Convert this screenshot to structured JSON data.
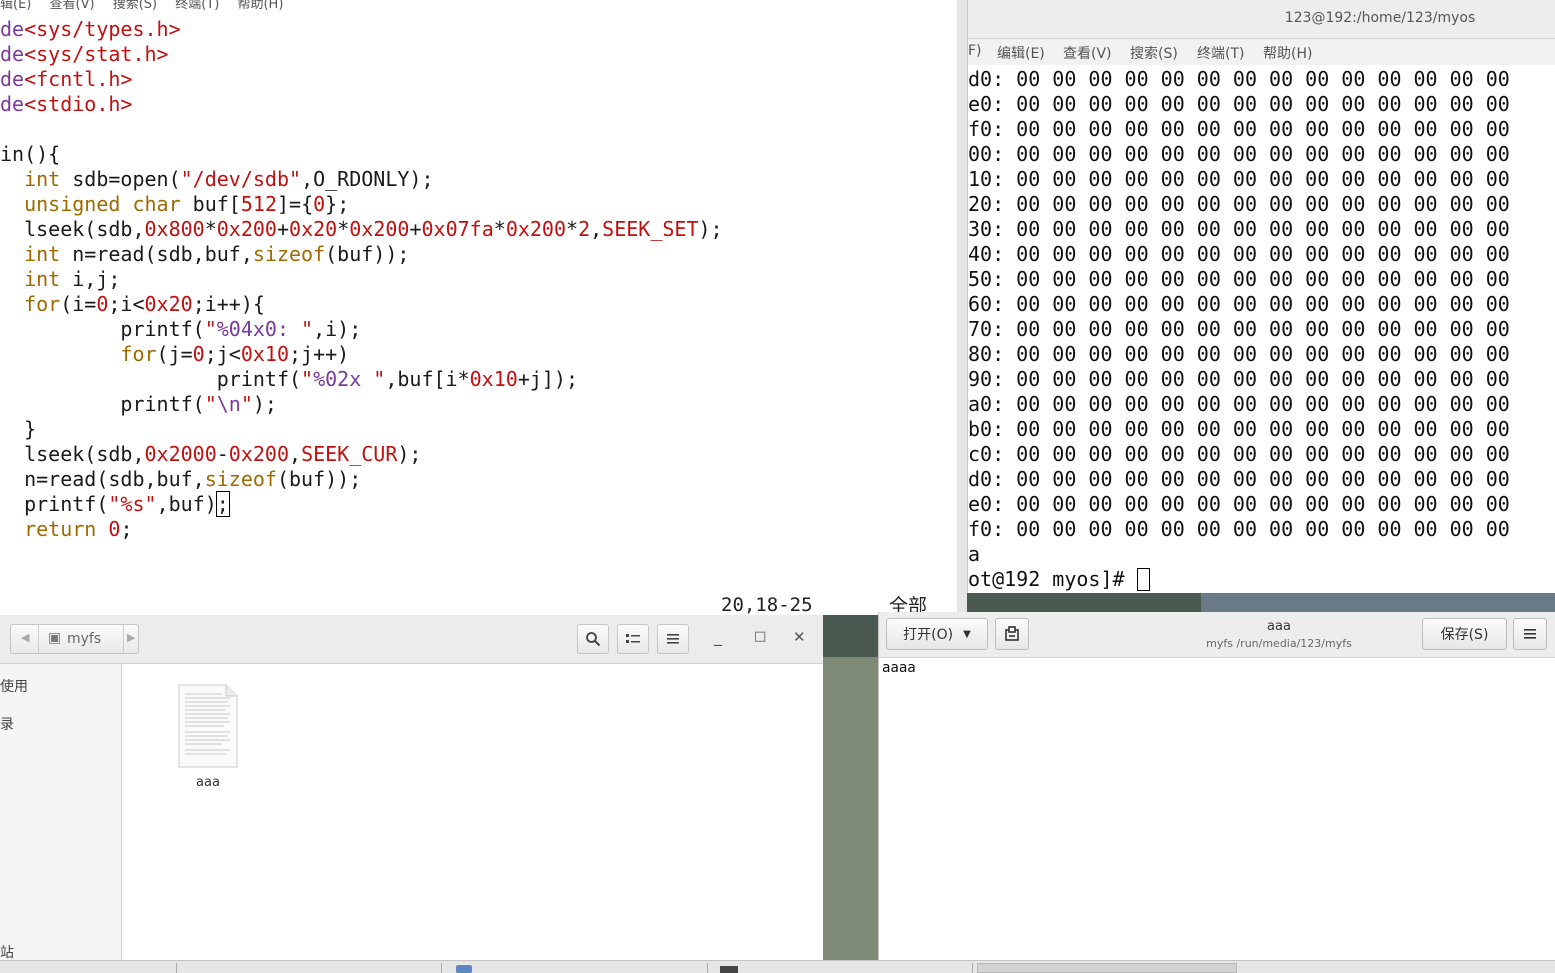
{
  "vim": {
    "menu": [
      "辑(E)",
      "查看(V)",
      "搜索(S)",
      "终端(T)",
      "帮助(H)"
    ],
    "code_lines": [
      {
        "spans": [
          {
            "c": "pp",
            "t": "de"
          },
          {
            "c": "st",
            "t": "<sys/types.h>"
          }
        ]
      },
      {
        "spans": [
          {
            "c": "pp",
            "t": "de"
          },
          {
            "c": "st",
            "t": "<sys/stat.h>"
          }
        ]
      },
      {
        "spans": [
          {
            "c": "pp",
            "t": "de"
          },
          {
            "c": "st",
            "t": "<fcntl.h>"
          }
        ]
      },
      {
        "spans": [
          {
            "c": "pp",
            "t": "de"
          },
          {
            "c": "st",
            "t": "<stdio.h>"
          }
        ]
      },
      {
        "spans": []
      },
      {
        "spans": [
          {
            "c": "",
            "t": "in(){"
          }
        ]
      },
      {
        "spans": [
          {
            "c": "",
            "t": "  "
          },
          {
            "c": "kw",
            "t": "int"
          },
          {
            "c": "",
            "t": " sdb=open("
          },
          {
            "c": "st",
            "t": "\"/dev/sdb\""
          },
          {
            "c": "",
            "t": ",O_RDONLY);"
          }
        ]
      },
      {
        "spans": [
          {
            "c": "",
            "t": "  "
          },
          {
            "c": "kw",
            "t": "unsigned char"
          },
          {
            "c": "",
            "t": " buf["
          },
          {
            "c": "nm",
            "t": "512"
          },
          {
            "c": "",
            "t": "]={"
          },
          {
            "c": "nm",
            "t": "0"
          },
          {
            "c": "",
            "t": "};"
          }
        ]
      },
      {
        "spans": [
          {
            "c": "",
            "t": "  lseek(sdb,"
          },
          {
            "c": "nm",
            "t": "0x800"
          },
          {
            "c": "",
            "t": "*"
          },
          {
            "c": "nm",
            "t": "0x200"
          },
          {
            "c": "",
            "t": "+"
          },
          {
            "c": "nm",
            "t": "0x20"
          },
          {
            "c": "",
            "t": "*"
          },
          {
            "c": "nm",
            "t": "0x200"
          },
          {
            "c": "",
            "t": "+"
          },
          {
            "c": "nm",
            "t": "0x07fa"
          },
          {
            "c": "",
            "t": "*"
          },
          {
            "c": "nm",
            "t": "0x200"
          },
          {
            "c": "",
            "t": "*"
          },
          {
            "c": "nm",
            "t": "2"
          },
          {
            "c": "",
            "t": ","
          },
          {
            "c": "st",
            "t": "SEEK_SET"
          },
          {
            "c": "",
            "t": ");"
          }
        ]
      },
      {
        "spans": [
          {
            "c": "",
            "t": "  "
          },
          {
            "c": "kw",
            "t": "int"
          },
          {
            "c": "",
            "t": " n=read(sdb,buf,"
          },
          {
            "c": "kw",
            "t": "sizeof"
          },
          {
            "c": "",
            "t": "(buf));"
          }
        ]
      },
      {
        "spans": [
          {
            "c": "",
            "t": "  "
          },
          {
            "c": "kw",
            "t": "int"
          },
          {
            "c": "",
            "t": " i,j;"
          }
        ]
      },
      {
        "spans": [
          {
            "c": "",
            "t": "  "
          },
          {
            "c": "kw",
            "t": "for"
          },
          {
            "c": "",
            "t": "(i="
          },
          {
            "c": "nm",
            "t": "0"
          },
          {
            "c": "",
            "t": ";i<"
          },
          {
            "c": "nm",
            "t": "0x20"
          },
          {
            "c": "",
            "t": ";i++){"
          }
        ]
      },
      {
        "spans": [
          {
            "c": "",
            "t": "          printf("
          },
          {
            "c": "st",
            "t": "\""
          },
          {
            "c": "pp",
            "t": "%04x0:"
          },
          {
            "c": "st",
            "t": " \""
          },
          {
            "c": "",
            "t": ",i);"
          }
        ]
      },
      {
        "spans": [
          {
            "c": "",
            "t": "          "
          },
          {
            "c": "kw",
            "t": "for"
          },
          {
            "c": "",
            "t": "(j="
          },
          {
            "c": "nm",
            "t": "0"
          },
          {
            "c": "",
            "t": ";j<"
          },
          {
            "c": "nm",
            "t": "0x10"
          },
          {
            "c": "",
            "t": ";j++)"
          }
        ]
      },
      {
        "spans": [
          {
            "c": "",
            "t": "                  printf("
          },
          {
            "c": "st",
            "t": "\""
          },
          {
            "c": "pp",
            "t": "%02x"
          },
          {
            "c": "st",
            "t": " \""
          },
          {
            "c": "",
            "t": ",buf[i*"
          },
          {
            "c": "nm",
            "t": "0x10"
          },
          {
            "c": "",
            "t": "+j]);"
          }
        ]
      },
      {
        "spans": [
          {
            "c": "",
            "t": "          printf("
          },
          {
            "c": "st",
            "t": "\""
          },
          {
            "c": "pp",
            "t": "\\n"
          },
          {
            "c": "st",
            "t": "\""
          },
          {
            "c": "",
            "t": ");"
          }
        ]
      },
      {
        "spans": [
          {
            "c": "",
            "t": "  }"
          }
        ]
      },
      {
        "spans": [
          {
            "c": "",
            "t": "  lseek(sdb,"
          },
          {
            "c": "nm",
            "t": "0x2000"
          },
          {
            "c": "",
            "t": "-"
          },
          {
            "c": "nm",
            "t": "0x200"
          },
          {
            "c": "",
            "t": ","
          },
          {
            "c": "st",
            "t": "SEEK_CUR"
          },
          {
            "c": "",
            "t": ");"
          }
        ]
      },
      {
        "spans": [
          {
            "c": "",
            "t": "  n=read(sdb,buf,"
          },
          {
            "c": "kw",
            "t": "sizeof"
          },
          {
            "c": "",
            "t": "(buf));"
          }
        ]
      },
      {
        "spans": [
          {
            "c": "",
            "t": "  printf("
          },
          {
            "c": "st",
            "t": "\"%s\""
          },
          {
            "c": "",
            "t": ",buf)"
          },
          {
            "c": "cursor",
            "t": ";"
          }
        ]
      },
      {
        "spans": [
          {
            "c": "",
            "t": "  "
          },
          {
            "c": "kw",
            "t": "return"
          },
          {
            "c": "",
            "t": " "
          },
          {
            "c": "nm",
            "t": "0"
          },
          {
            "c": "",
            "t": ";"
          }
        ]
      }
    ],
    "status_position": "20,18-25",
    "status_scope": "全部"
  },
  "terminal": {
    "title": "123@192:/home/123/myos",
    "menu": [
      "F)",
      "编辑(E)",
      "查看(V)",
      "搜索(S)",
      "终端(T)",
      "帮助(H)"
    ],
    "hex_prefixes": [
      "d0:",
      "e0:",
      "f0:",
      "00:",
      "10:",
      "20:",
      "30:",
      "40:",
      "50:",
      "60:",
      "70:",
      "80:",
      "90:",
      "a0:",
      "b0:",
      "c0:",
      "d0:",
      "e0:",
      "f0:"
    ],
    "hex_bytes": "00 00 00 00 00 00 00 00 00 00 00 00 00 00",
    "output_line": "a",
    "prompt": "ot@192 myos]# "
  },
  "filemanager": {
    "path": "myfs",
    "sidebar": [
      "使用",
      "录",
      "站"
    ],
    "file_name": "aaa"
  },
  "gedit": {
    "open_label": "打开(O)",
    "title": "aaa",
    "subtitle": "myfs /run/media/123/myfs",
    "save_label": "保存(S)",
    "content": "aaaa"
  }
}
